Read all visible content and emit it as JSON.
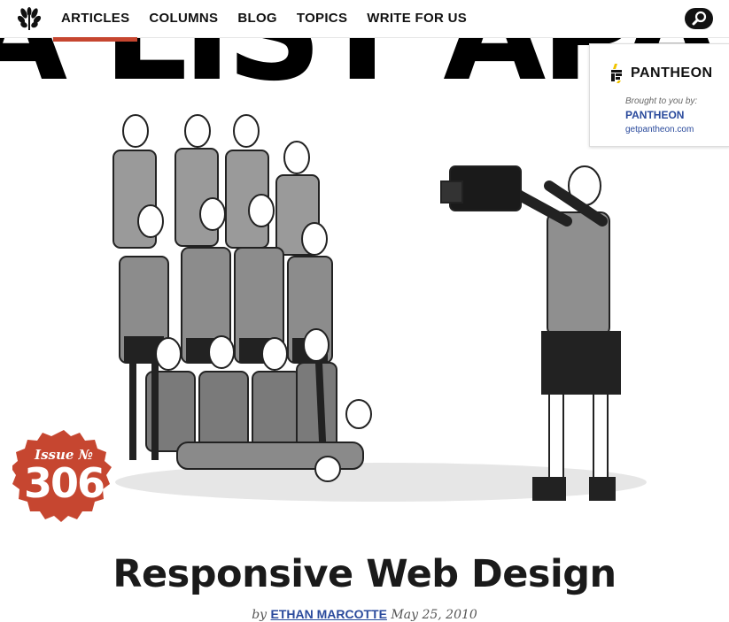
{
  "nav": {
    "logo_icon": "laurel-icon",
    "items": [
      {
        "label": "ARTICLES",
        "active": true
      },
      {
        "label": "COLUMNS"
      },
      {
        "label": "BLOG"
      },
      {
        "label": "TOPICS"
      },
      {
        "label": "WRITE FOR US"
      }
    ],
    "search_icon": "search-icon"
  },
  "masthead": {
    "text": "A LIST APART"
  },
  "sponsor": {
    "brand": "PANTHEON",
    "brought_by": "Brought to you by:",
    "name": "PANTHEON",
    "url": "getpantheon.com"
  },
  "issue": {
    "label": "Issue №",
    "number": "306"
  },
  "article": {
    "title": "Responsive Web Design",
    "byline_prefix": "by",
    "author": "ETHAN MARCOTTE",
    "date": "May 25, 2010"
  },
  "colors": {
    "accent": "#c64630",
    "link": "#2a4a9c",
    "text": "#111111"
  }
}
